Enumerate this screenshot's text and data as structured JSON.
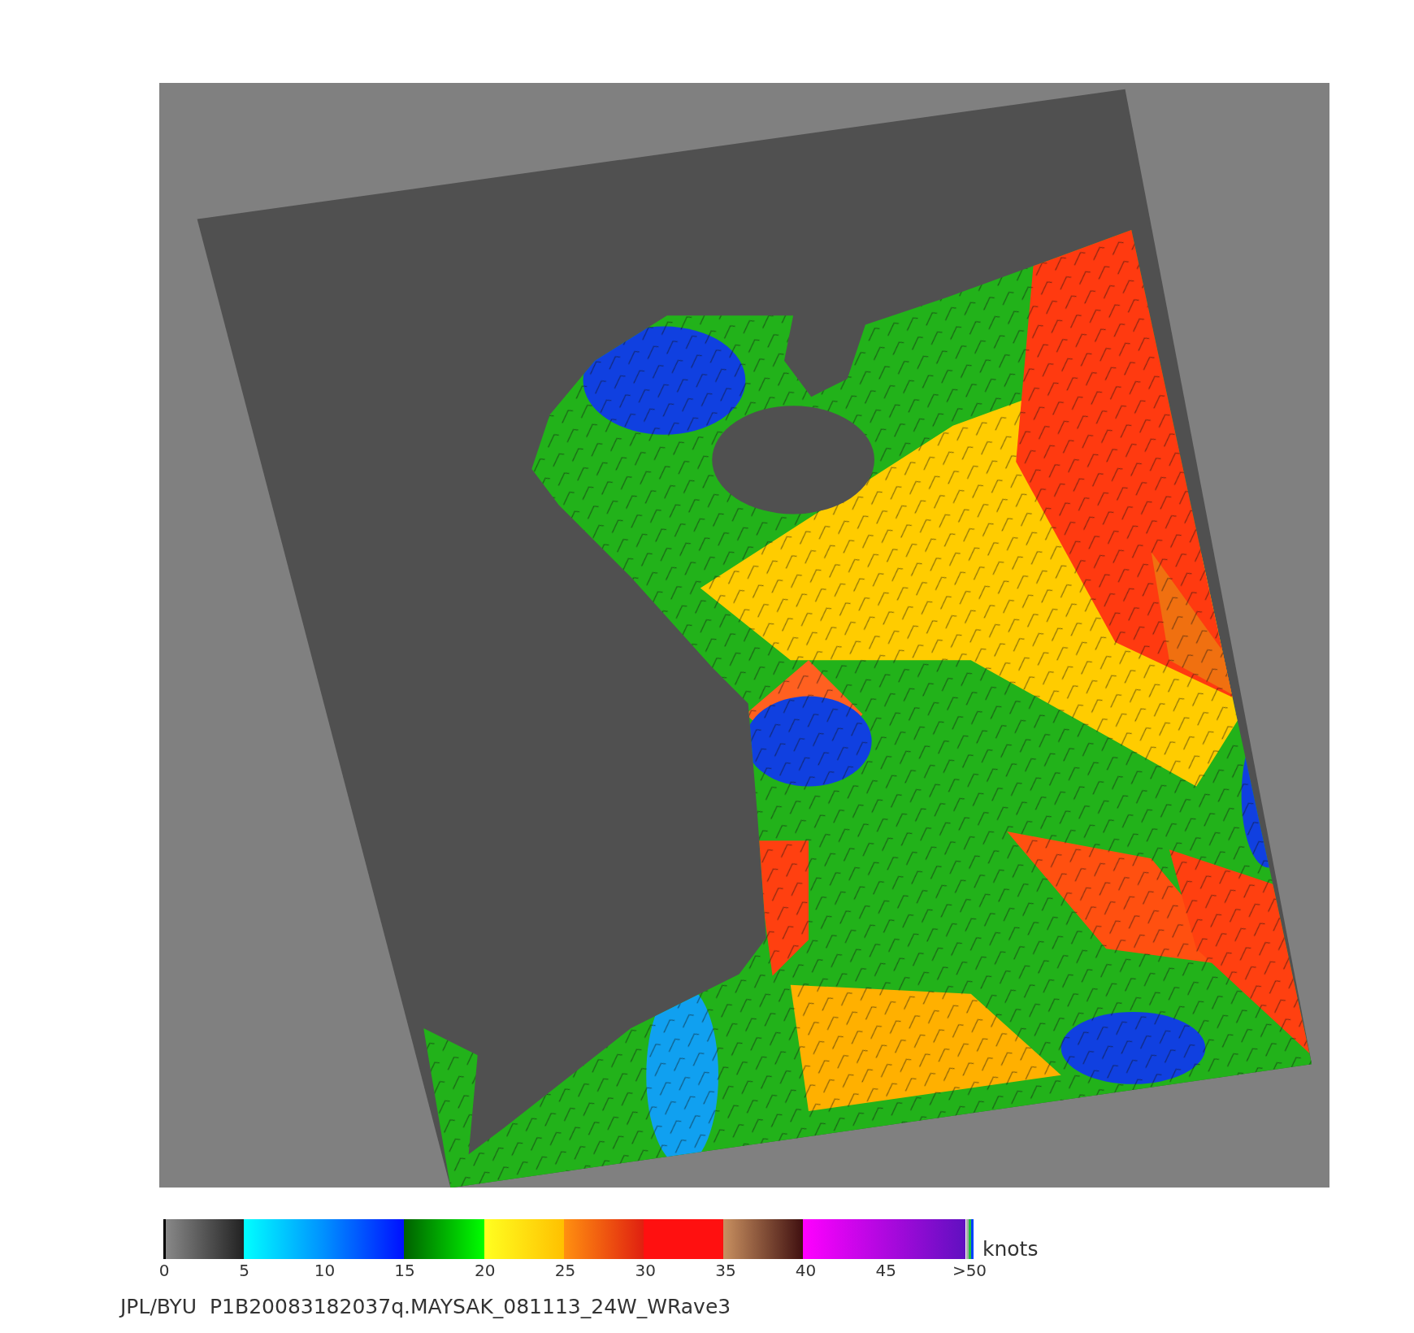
{
  "colorbar": {
    "ticks": [
      "0",
      "5",
      "10",
      "15",
      "20",
      "25",
      "30",
      "35",
      "40",
      "45",
      ">50"
    ],
    "unit": "knots"
  },
  "caption": {
    "source": "JPL/BYU",
    "filename": "P1B20083182037q.MAYSAK_081113_24W_WRave3"
  }
}
